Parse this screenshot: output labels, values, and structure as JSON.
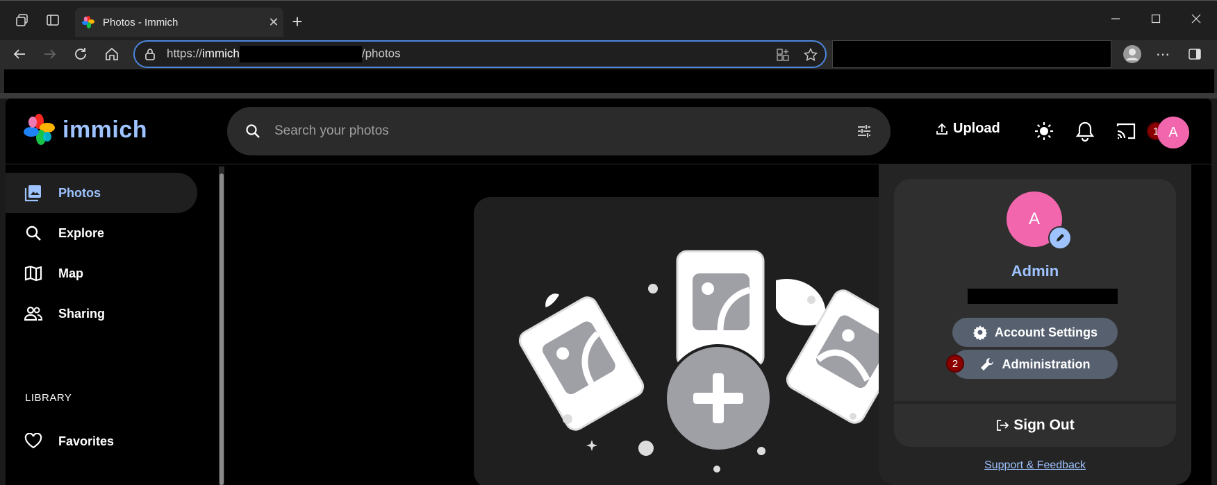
{
  "browser": {
    "tab_title": "Photos - Immich",
    "url_scheme": "https://",
    "url_host": "immich",
    "url_path": "/photos"
  },
  "app": {
    "logo_text": "immich",
    "search_placeholder": "Search your photos",
    "upload_label": "Upload"
  },
  "sidebar": {
    "items": [
      {
        "label": "Photos"
      },
      {
        "label": "Explore"
      },
      {
        "label": "Map"
      },
      {
        "label": "Sharing"
      }
    ],
    "section_label": "LIBRARY",
    "library_items": [
      {
        "label": "Favorites"
      }
    ]
  },
  "account_menu": {
    "avatar_letter": "A",
    "user_name": "Admin",
    "account_settings_label": "Account Settings",
    "administration_label": "Administration",
    "sign_out_label": "Sign Out",
    "support_label": "Support & Feedback"
  },
  "badges": {
    "avatar_badge": "1",
    "administration_badge": "2"
  },
  "colors": {
    "accent": "#9ec3ff",
    "avatar": "#f166ad",
    "badge": "#8b0000"
  }
}
